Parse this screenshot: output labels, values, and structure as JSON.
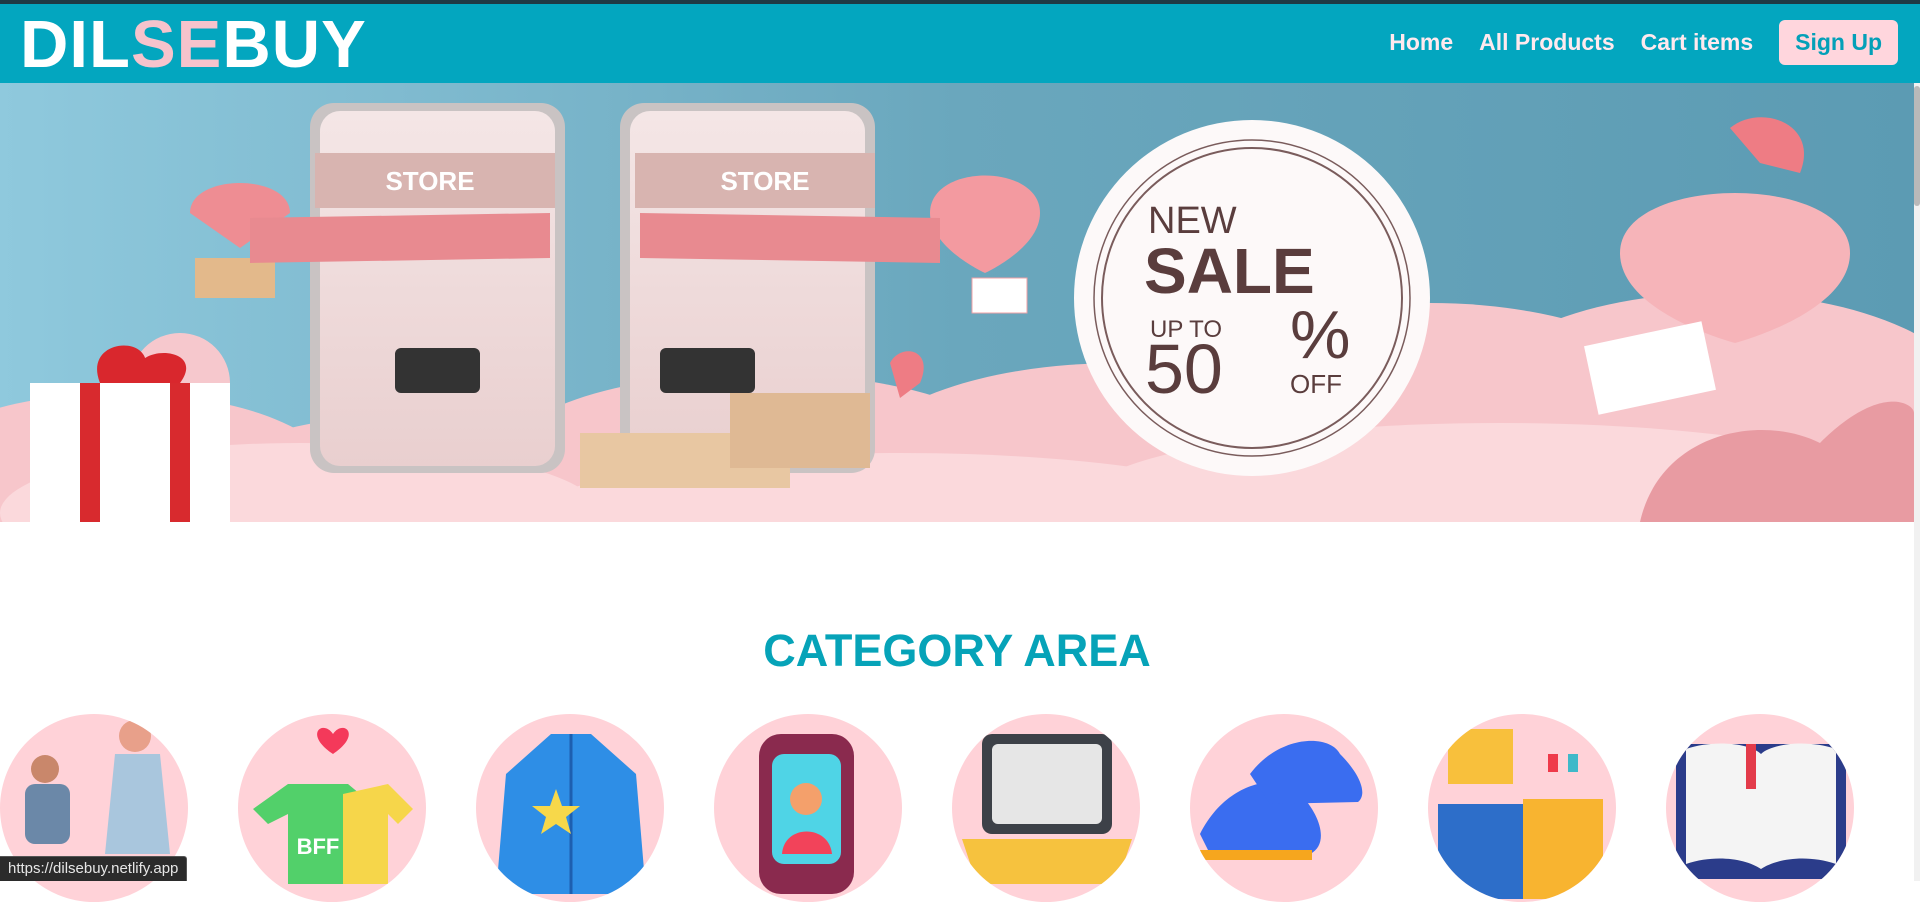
{
  "brand": {
    "part1": "DIL",
    "part2": "SE",
    "part3": "BUY"
  },
  "nav": {
    "home": "Home",
    "all_products": "All Products",
    "cart_items": "Cart items",
    "sign_up": "Sign Up"
  },
  "banner": {
    "store_label": "STORE",
    "sale_new": "NEW",
    "sale_word": "SALE",
    "sale_upto": "UP TO",
    "sale_value": "50",
    "sale_percent": "%",
    "sale_off": "OFF"
  },
  "category": {
    "title": "CATEGORY AREA",
    "items": [
      {
        "icon": "couple-proposal-icon"
      },
      {
        "icon": "bff-tshirts-icon",
        "text": "BFF"
      },
      {
        "icon": "denim-jacket-icon"
      },
      {
        "icon": "smartphone-icon"
      },
      {
        "icon": "laptop-icon"
      },
      {
        "icon": "sneakers-icon"
      },
      {
        "icon": "kitchen-icon"
      },
      {
        "icon": "open-book-icon"
      }
    ]
  },
  "status_bar": {
    "url": "https://dilsebuy.netlify.app"
  },
  "colors": {
    "primary": "#03a6bf",
    "accent_pink": "#f6c3cc",
    "category_title": "#06a3b8",
    "circle_bg": "#ffd2d8"
  }
}
